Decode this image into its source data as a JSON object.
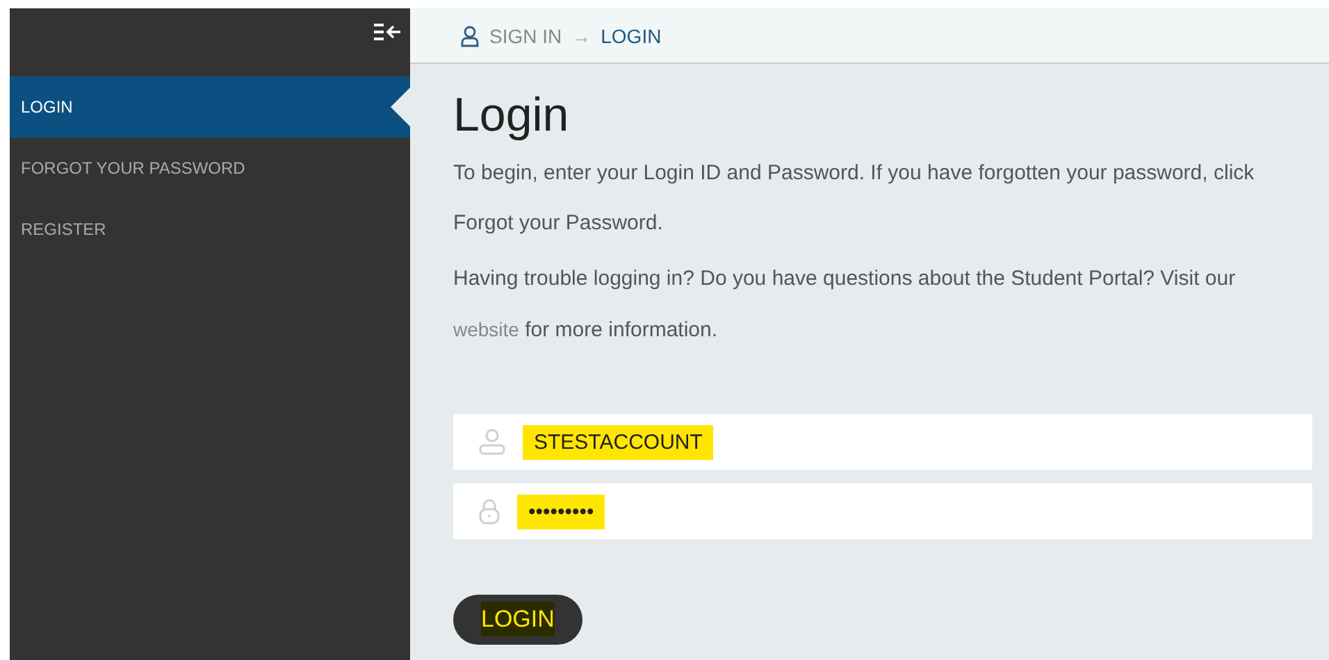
{
  "sidebar": {
    "items": [
      {
        "label": "LOGIN",
        "selected": true
      },
      {
        "label": "FORGOT YOUR PASSWORD",
        "selected": false
      },
      {
        "label": "REGISTER",
        "selected": false
      }
    ]
  },
  "breadcrumb": {
    "items": [
      {
        "label": "SIGN IN",
        "current": false
      },
      {
        "label": "LOGIN",
        "current": true
      }
    ],
    "separator": "→"
  },
  "heading": "Login",
  "intro": "To begin, enter your Login ID and Password. If you have forgotten your password, click Forgot your Password.",
  "help": {
    "before": "Having trouble logging in? Do you have questions about the Student Portal? Visit our",
    "link": "website",
    "after": "for more information."
  },
  "fields": [
    {
      "kind": "user",
      "value": "STESTACCOUNT"
    },
    {
      "kind": "password",
      "value": "•••••••••"
    }
  ],
  "button": "LOGIN"
}
